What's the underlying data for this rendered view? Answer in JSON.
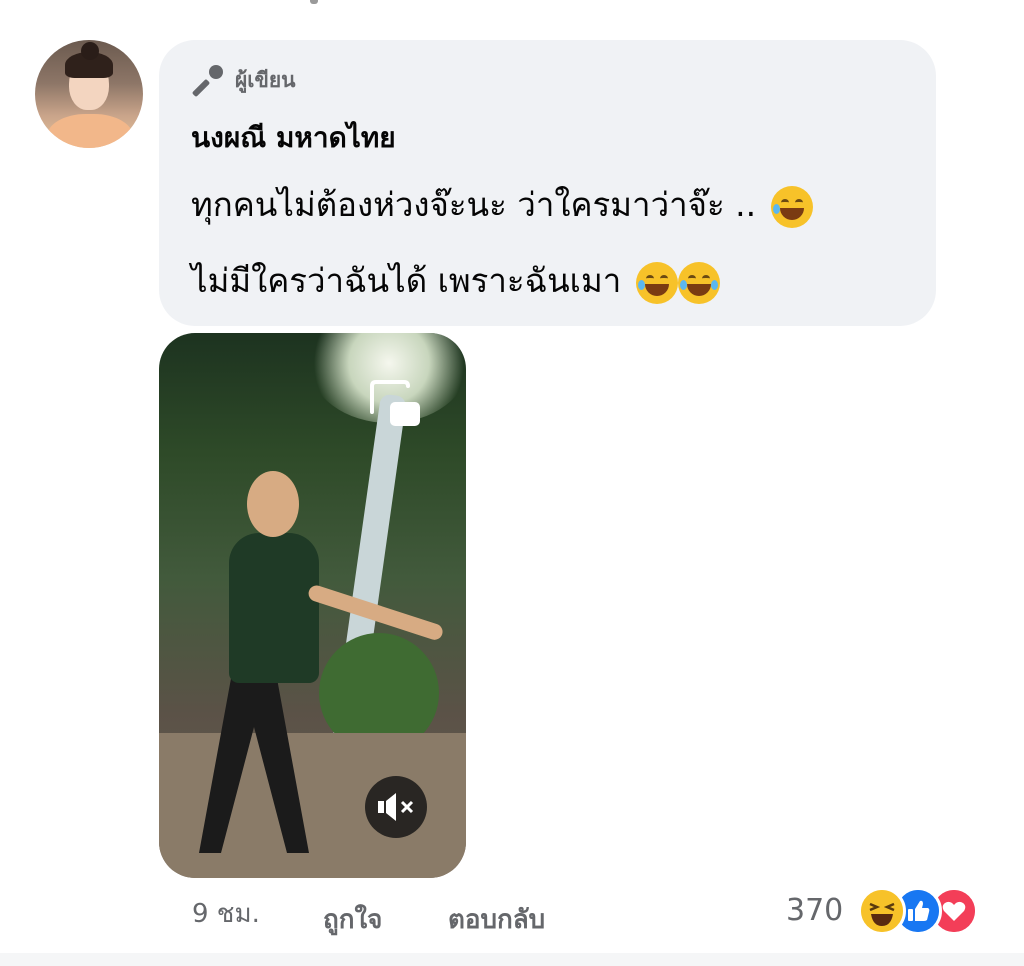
{
  "comment": {
    "badge_label": "ผู้เขียน",
    "badge_icon": "microphone-icon",
    "author": "นงผณี มหาดไทย",
    "line1": "ทุกคนไม่ต้องห่วงจ๊ะนะ ว่าใครมาว่าจ๊ะ ..",
    "line2": "ไม่มีใครว่าฉันได้ เพราะฉันเมา",
    "line1_emoji": [
      "rolling-on-floor-laughing-emoji"
    ],
    "line2_emoji": [
      "rolling-on-floor-laughing-emoji",
      "tears-of-joy-emoji"
    ]
  },
  "video": {
    "pip_icon": "picture-in-picture-icon",
    "mute_icon": "sound-muted-icon"
  },
  "actions": {
    "time": "9 ชม.",
    "like_label": "ถูกใจ",
    "reply_label": "ตอบกลับ",
    "reaction_count": "370",
    "reactions": [
      "haha",
      "like",
      "love"
    ]
  },
  "colors": {
    "bubble": "#f0f2f5",
    "secondary_text": "#65676b",
    "like_blue": "#1877f2",
    "love_red": "#f33e58",
    "haha_yellow": "#f7c229"
  }
}
